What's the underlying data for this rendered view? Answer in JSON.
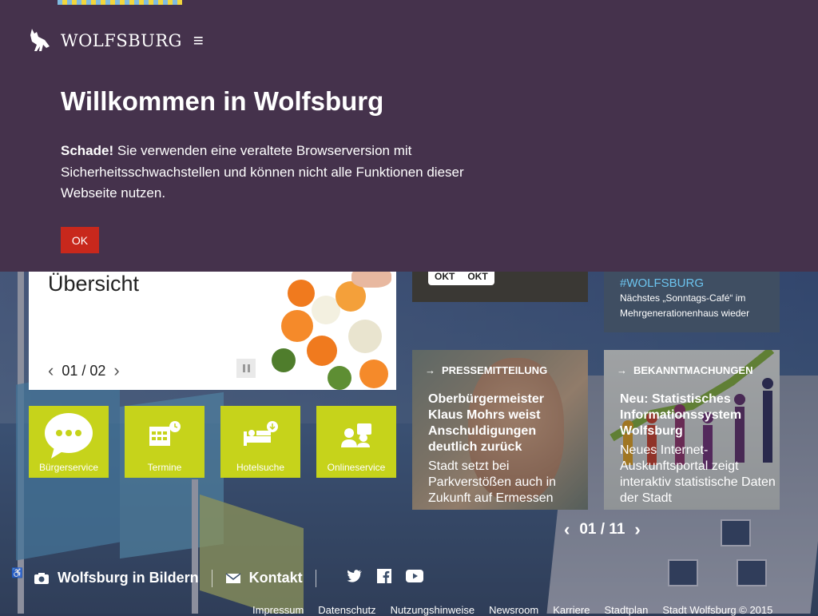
{
  "header": {
    "brand": "WOLFSBURG",
    "menu_icon": "hamburger-icon",
    "logo_icon": "wolf-logo-icon"
  },
  "modal": {
    "title": "Willkommen in Wolfsburg",
    "message_bold": "Schade!",
    "message": " Sie verwenden eine veraltete Browserversion mit Sicherheitsschwachstellen und können nicht alle Funktionen dieser Webseite nutzen.",
    "ok_label": "OK"
  },
  "slider": {
    "title": "Übersicht",
    "pager": "01 / 02"
  },
  "services": [
    {
      "label": "Bürgerservice",
      "icon": "speech-bubble-icon"
    },
    {
      "label": "Termine",
      "icon": "calendar-icon"
    },
    {
      "label": "Hotelsuche",
      "icon": "hotel-bed-icon"
    },
    {
      "label": "Onlineservice",
      "icon": "people-icon"
    }
  ],
  "weather": {
    "tab1": "OKT",
    "tab2": "OKT"
  },
  "hashtag": {
    "tag": "#WOLFSBURG",
    "text": "Nächstes „Sonntags-Café“ im Mehrgenerationenhaus wieder"
  },
  "news": [
    {
      "category": "PRESSEMITTEILUNG",
      "headline": "Oberbürgermeister Klaus Mohrs weist Anschuldigungen deutlich zurück",
      "sub": "Stadt setzt bei Parkverstößen auch in Zukunft auf Ermessen"
    },
    {
      "category": "BEKANNTMACHUNGEN",
      "headline": "Neu: Statistisches Informationssystem Wolfsburg",
      "sub": "Neues Internet-Auskunftsportal zeigt interaktiv statistische Daten der Stadt"
    }
  ],
  "news_pager": "01 / 11",
  "footer": {
    "bilder": "Wolfsburg in Bildern",
    "kontakt": "Kontakt",
    "links": [
      "Impressum",
      "Datenschutz",
      "Nutzungshinweise",
      "Newsroom",
      "Karriere",
      "Stadtplan",
      "Stadt Wolfsburg © 2015"
    ]
  },
  "colors": {
    "modal_bg": "#45324c",
    "tile_green": "#c6d31b",
    "ok_red": "#c8281c",
    "hashtag_blue": "#6cc4ef"
  }
}
